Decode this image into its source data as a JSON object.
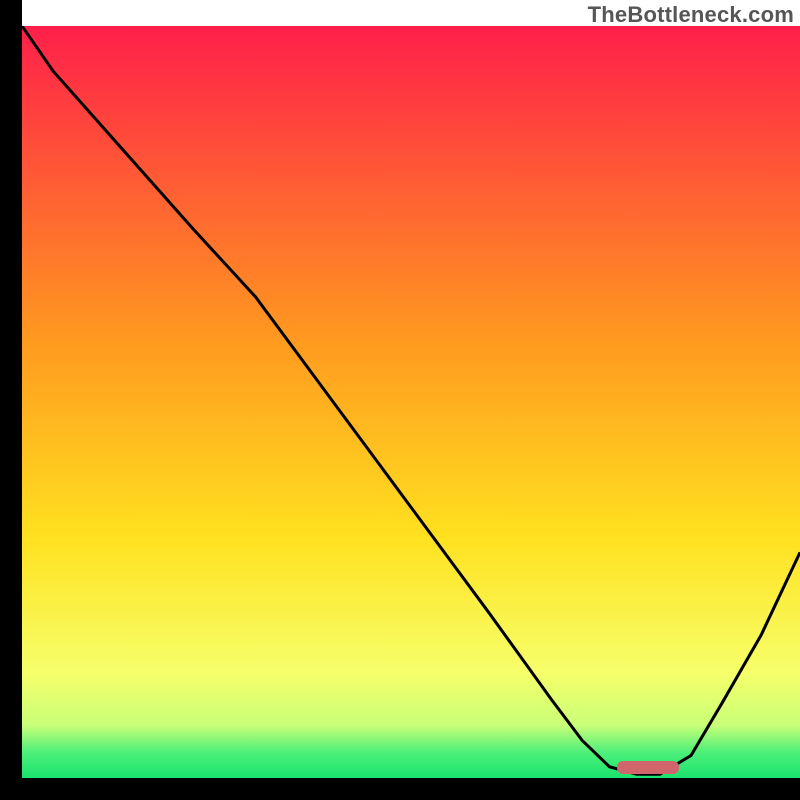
{
  "attribution": "TheBottleneck.com",
  "chart_data": {
    "type": "line",
    "title": "",
    "xlabel": "",
    "ylabel": "",
    "xlim": [
      0,
      100
    ],
    "ylim": [
      0,
      100
    ],
    "grid": false,
    "legend": false,
    "gradient_stops": [
      {
        "offset": 0.0,
        "color": "#ff1f4a"
      },
      {
        "offset": 0.42,
        "color": "#ff9a1f"
      },
      {
        "offset": 0.68,
        "color": "#ffe11f"
      },
      {
        "offset": 0.86,
        "color": "#f6ff6a"
      },
      {
        "offset": 0.93,
        "color": "#c9ff78"
      },
      {
        "offset": 0.965,
        "color": "#4ff07a"
      },
      {
        "offset": 1.0,
        "color": "#19e36d"
      }
    ],
    "series": [
      {
        "name": "curve",
        "color": "#000000",
        "width": 3,
        "x": [
          0.0,
          4,
          10,
          16,
          22,
          26,
          30,
          40,
          50,
          60,
          68,
          72,
          75.5,
          79,
          82,
          86,
          90,
          95,
          100
        ],
        "y": [
          100,
          94,
          87,
          80,
          73,
          68.5,
          64,
          50,
          36,
          22,
          10.5,
          5,
          1.5,
          0.5,
          0.5,
          3,
          10,
          19,
          30
        ]
      }
    ],
    "marker": {
      "name": "optimal-zone",
      "color": "#d1656c",
      "x_start": 76.5,
      "x_end": 84.5,
      "y": 0.6,
      "height": 1.6
    }
  }
}
